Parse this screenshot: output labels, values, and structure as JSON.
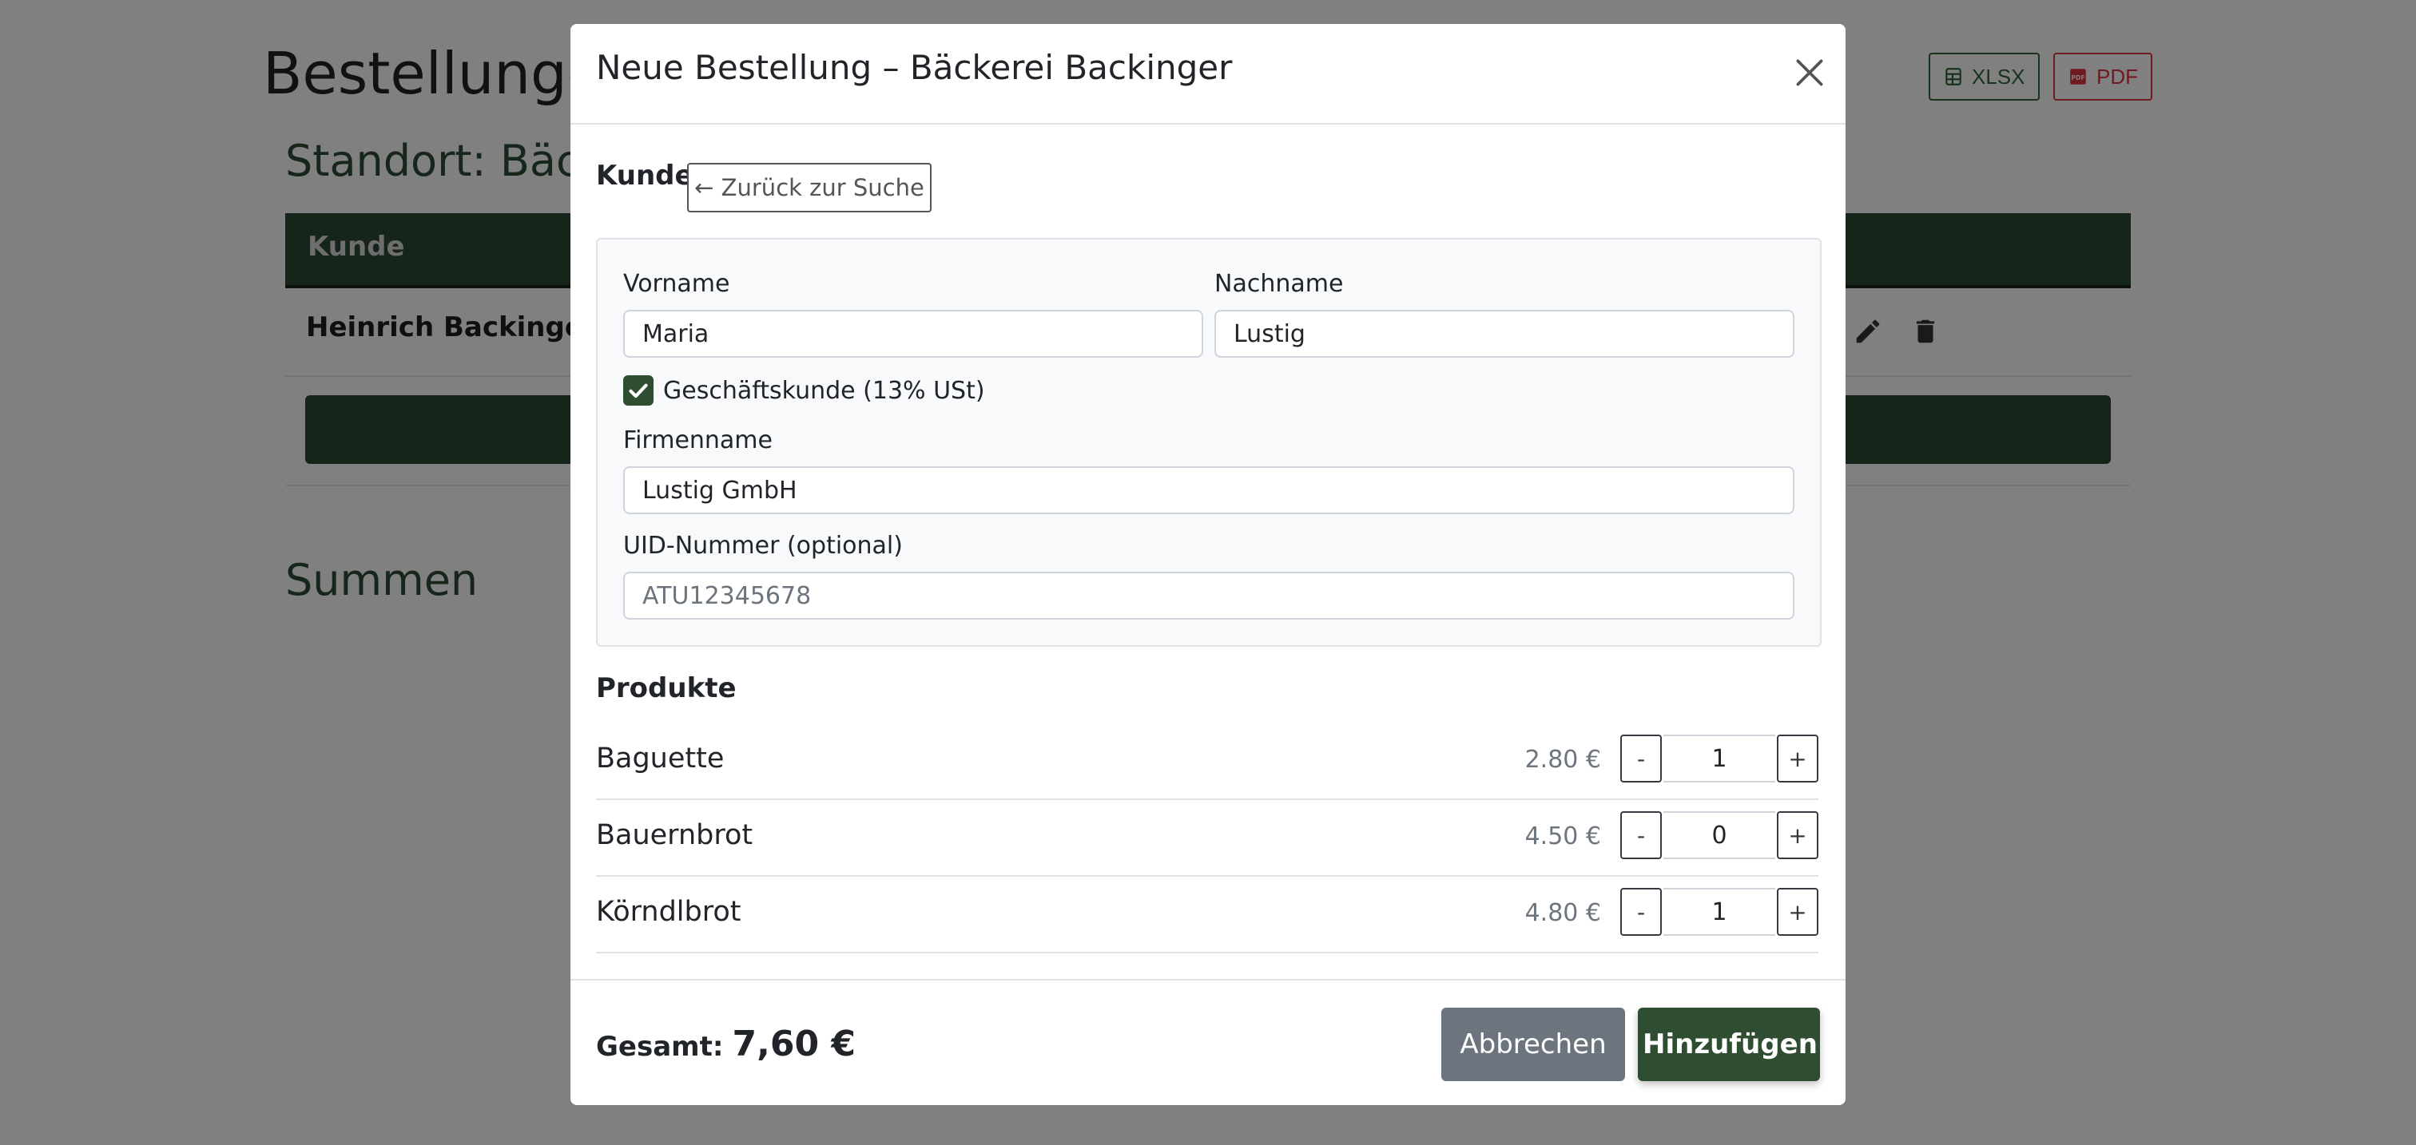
{
  "colors": {
    "brand_green": "#2e4d31",
    "xlsx": "#18331c",
    "pdf": "#6e1a1f",
    "backdrop": "#7f7f7f"
  },
  "page": {
    "title": "Bestellungen",
    "export_xlsx": "XLSX",
    "export_pdf": "PDF",
    "standort": "Standort: Bäckerei Backinger",
    "table_header_kunde": "Kunde",
    "row_name": "Heinrich Backinger",
    "summen": "Summen"
  },
  "modal": {
    "title": "Neue Bestellung – Bäckerei Backinger",
    "kunde_label": "Kunde",
    "back_button": "← Zurück zur Suche",
    "vorname_label": "Vorname",
    "vorname_value": "Maria",
    "nachname_label": "Nachname",
    "nachname_value": "Lustig",
    "business_checkbox_label": "Geschäftskunde (13% USt)",
    "business_checked": true,
    "firmenname_label": "Firmenname",
    "firmenname_value": "Lustig GmbH",
    "uid_label": "UID-Nummer (optional)",
    "uid_placeholder": "ATU12345678",
    "produkte_label": "Produkte",
    "products": [
      {
        "name": "Baguette",
        "price": "2.80 €",
        "qty": "1"
      },
      {
        "name": "Bauernbrot",
        "price": "4.50 €",
        "qty": "0"
      },
      {
        "name": "Körndlbrot",
        "price": "4.80 €",
        "qty": "1"
      }
    ],
    "minus": "-",
    "plus": "+",
    "total_label": "Gesamt:",
    "total_value": "7,60 €",
    "cancel_button": "Abbrechen",
    "add_button": "Hinzufügen"
  },
  "icons": [
    "spreadsheet-icon",
    "pdf-file-icon",
    "pencil-icon",
    "trash-icon",
    "close-icon",
    "checkmark-icon"
  ]
}
